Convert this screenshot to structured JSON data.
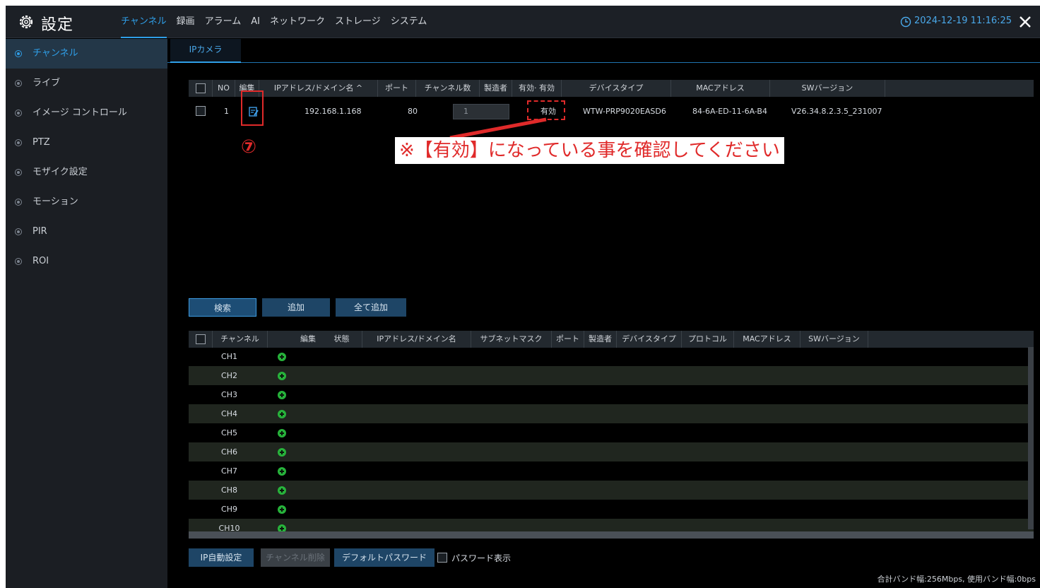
{
  "header": {
    "title": "設定",
    "tabs": [
      "チャンネル",
      "録画",
      "アラーム",
      "AI",
      "ネットワーク",
      "ストレージ",
      "システム"
    ],
    "datetime": "2024-12-19 11:16:25"
  },
  "sidebar": {
    "items": [
      {
        "label": "チャンネル",
        "active": true
      },
      {
        "label": "ライブ"
      },
      {
        "label": "イメージ コントロール"
      },
      {
        "label": "PTZ"
      },
      {
        "label": "モザイク設定"
      },
      {
        "label": "モーション"
      },
      {
        "label": "PIR"
      },
      {
        "label": "ROI"
      }
    ]
  },
  "subtab": {
    "label": "IPカメラ"
  },
  "added_table": {
    "columns": {
      "no": "NO",
      "edit": "編集",
      "address": "IPアドレス/ドメイン名 ^",
      "port": "ポート",
      "channels": "チャンネル数",
      "maker": "製造者",
      "valid": "有効· 有効",
      "device_type": "デバイスタイプ",
      "mac": "MACアドレス",
      "sw": "SWバージョン"
    },
    "row": {
      "no": "1",
      "address": "192.168.1.168",
      "port": "80",
      "channel_input": "1",
      "valid": "有効",
      "device_type": "WTW-PRP9020EASD6",
      "mac": "84-6A-ED-11-6A-B4",
      "sw": "V26.34.8.2.3.5_231007"
    }
  },
  "annotation": {
    "step": "⑦",
    "note": "※【有効】になっている事を確認してください",
    "color": "#e02a2a"
  },
  "search_buttons": {
    "search": "検索",
    "add": "追加",
    "add_all": "全て追加"
  },
  "search_table": {
    "columns": {
      "channel": "チャンネル",
      "edit": "編集",
      "status": "状態",
      "address": "IPアドレス/ドメイン名",
      "subnet": "サブネットマスク",
      "port": "ポート",
      "maker": "製造者",
      "device_type": "デバイスタイプ",
      "protocol": "プロトコル",
      "mac": "MACアドレス",
      "sw": "SWバージョン"
    },
    "rows": [
      "CH1",
      "CH2",
      "CH3",
      "CH4",
      "CH5",
      "CH6",
      "CH7",
      "CH8",
      "CH9",
      "CH10"
    ]
  },
  "footer": {
    "auto_ip": "IP自動設定",
    "delete_channel": "チャンネル削除",
    "default_password": "デフォルトパスワード",
    "show_password": "パスワード表示",
    "bandwidth": "合計バンド幅:256Mbps, 使用バンド幅:0bps"
  },
  "colors": {
    "accent": "#2f9fe8",
    "add_icon": "#27b33b"
  }
}
